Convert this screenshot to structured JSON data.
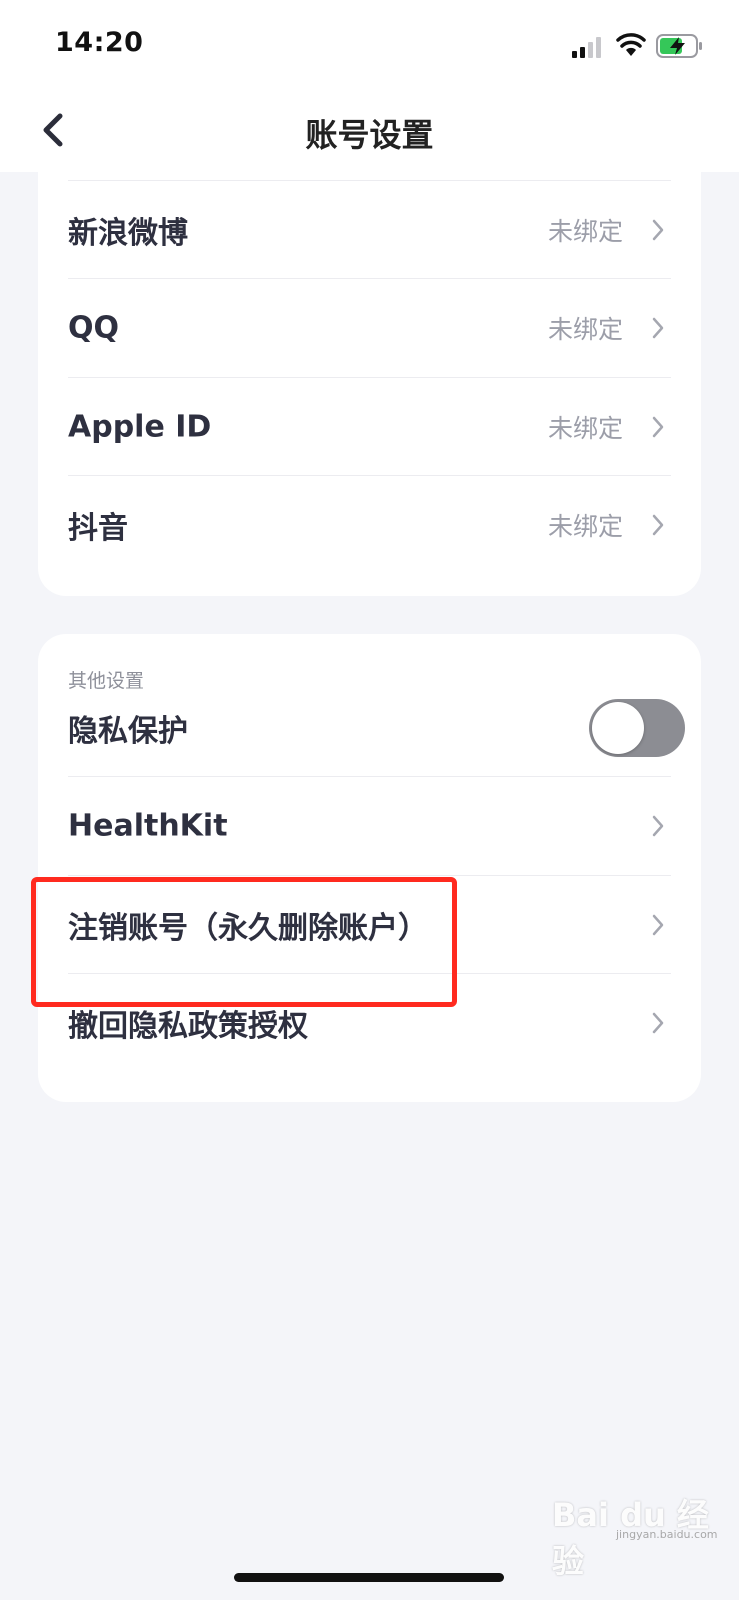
{
  "status_bar": {
    "time": "14:20"
  },
  "nav": {
    "title": "账号设置"
  },
  "bindings": [
    {
      "label": "新浪微博",
      "value": "未绑定"
    },
    {
      "label": "QQ",
      "value": "未绑定"
    },
    {
      "label": "Apple ID",
      "value": "未绑定"
    },
    {
      "label": "抖音",
      "value": "未绑定"
    }
  ],
  "other_settings": {
    "section_title": "其他设置",
    "privacy": {
      "label": "隐私保护",
      "enabled": false
    },
    "items": [
      {
        "label": "HealthKit"
      },
      {
        "label": "注销账号（永久删除账户）"
      },
      {
        "label": "撤回隐私政策授权"
      }
    ]
  },
  "watermark": {
    "text": "Bai du 经验",
    "url": "jingyan.baidu.com"
  },
  "colors": {
    "highlight": "#ff2a1f",
    "toggle_off": "#8c8d93",
    "background": "#f4f5f9"
  }
}
